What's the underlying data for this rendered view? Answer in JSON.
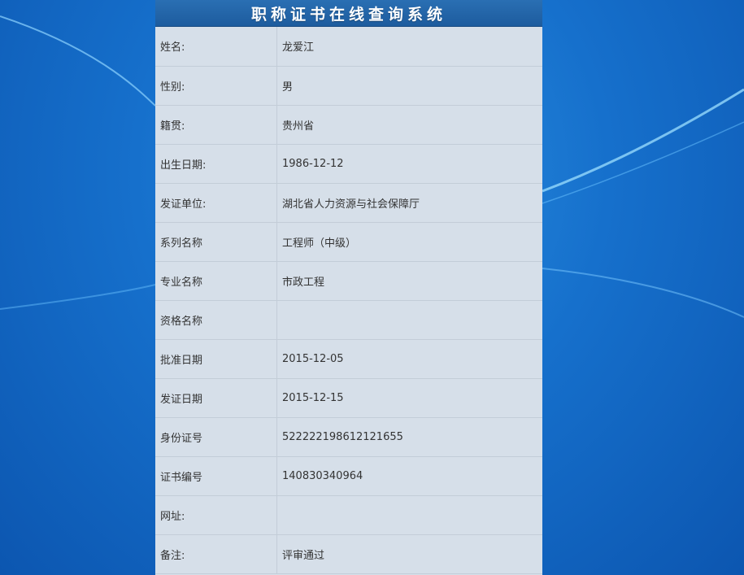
{
  "window": {
    "title": "职称证书在线查询系统"
  },
  "rows": [
    {
      "label": "姓名:",
      "value": "龙爱江"
    },
    {
      "label": "性别:",
      "value": "男"
    },
    {
      "label": "籍贯:",
      "value": "贵州省"
    },
    {
      "label": "出生日期:",
      "value": "1986-12-12"
    },
    {
      "label": "发证单位:",
      "value": "湖北省人力资源与社会保障厅"
    },
    {
      "label": "系列名称",
      "value": "工程师（中级）"
    },
    {
      "label": "专业名称",
      "value": "市政工程"
    },
    {
      "label": "资格名称",
      "value": ""
    },
    {
      "label": "批准日期",
      "value": "2015-12-05"
    },
    {
      "label": "发证日期",
      "value": "2015-12-15"
    },
    {
      "label": "身份证号",
      "value": "522222198612121655"
    },
    {
      "label": "证书编号",
      "value": "140830340964"
    },
    {
      "label": "网址:",
      "value": ""
    },
    {
      "label": "备注:",
      "value": "评审通过"
    }
  ],
  "colors": {
    "header": "#2266aa",
    "panel": "#d6dfe9",
    "desktop": "#1670cc"
  }
}
